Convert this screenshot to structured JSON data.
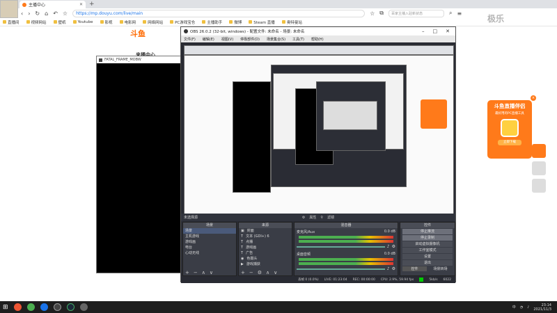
{
  "browser": {
    "tab_title": "主播中心",
    "new_tab": "+",
    "url": "https://mp.douyu.com/live/main",
    "search_hint": "百家主播入驻新状态"
  },
  "bookmarks": [
    "直播间",
    "视频网站",
    "壁纸",
    "Youtube",
    "影视",
    "电影网",
    "网络网站",
    "PC游戏宝仓",
    "主播助手",
    "微博",
    "Steam 直播",
    "奥特曼站"
  ],
  "page": {
    "logo": "斗鱼",
    "tagline": "来播中心"
  },
  "promo": {
    "title": "斗鱼直播伴侣",
    "subtitle": "最好用的PC直播工具",
    "download": "立即下载",
    "close": "×"
  },
  "fatal_frame": {
    "title": "FATAL_FRAME_MOBW"
  },
  "obs": {
    "title": "OBS 26.0.2 (32-bit, windows) - 配置文件: 未命名 - 场景: 未命名",
    "menu": [
      "文件(F)",
      "编辑(E)",
      "视图(V)",
      "停靠部件(D)",
      "场景集合(S)",
      "工具(T)",
      "帮助(H)"
    ],
    "no_source_selected": "未选择源",
    "properties": "属性",
    "filters": "滤镜",
    "scenes": {
      "header": "场景",
      "items": [
        "场景",
        "主机游戏",
        "游戏画",
        "电台",
        "心动无线"
      ]
    },
    "sources": {
      "header": "来源",
      "items": [
        "封面",
        "文本 (GDI+) 6",
        "点播",
        "游戏画",
        "广告",
        "色摄头",
        "游戏捕获"
      ]
    },
    "mixer": {
      "header": "混音器",
      "tracks": [
        {
          "name": "麦克风/Aux",
          "db": "0.0 dB"
        },
        {
          "name": "桌面音频",
          "db": "0.0 dB"
        }
      ]
    },
    "controls": {
      "header": "控件",
      "buttons": [
        "停止推流",
        "停止录制",
        "启动虚拟摄像机",
        "工作室模式",
        "设置",
        "退出"
      ],
      "footer_tabs": [
        "控件",
        "场景转场"
      ]
    },
    "status": {
      "dropped": "丢帧 0 (0.0%)",
      "live": "LIVE: 01:23:04",
      "rec": "REC: 00:00:00",
      "cpu": "CPU: 2.9%, 59.94 fps",
      "bitrate": "5kb/s",
      "kbps": "6022"
    }
  },
  "taskbar": {
    "lang": "中",
    "time": "23:14",
    "date": "2021/11/3"
  },
  "watermark": "极乐"
}
